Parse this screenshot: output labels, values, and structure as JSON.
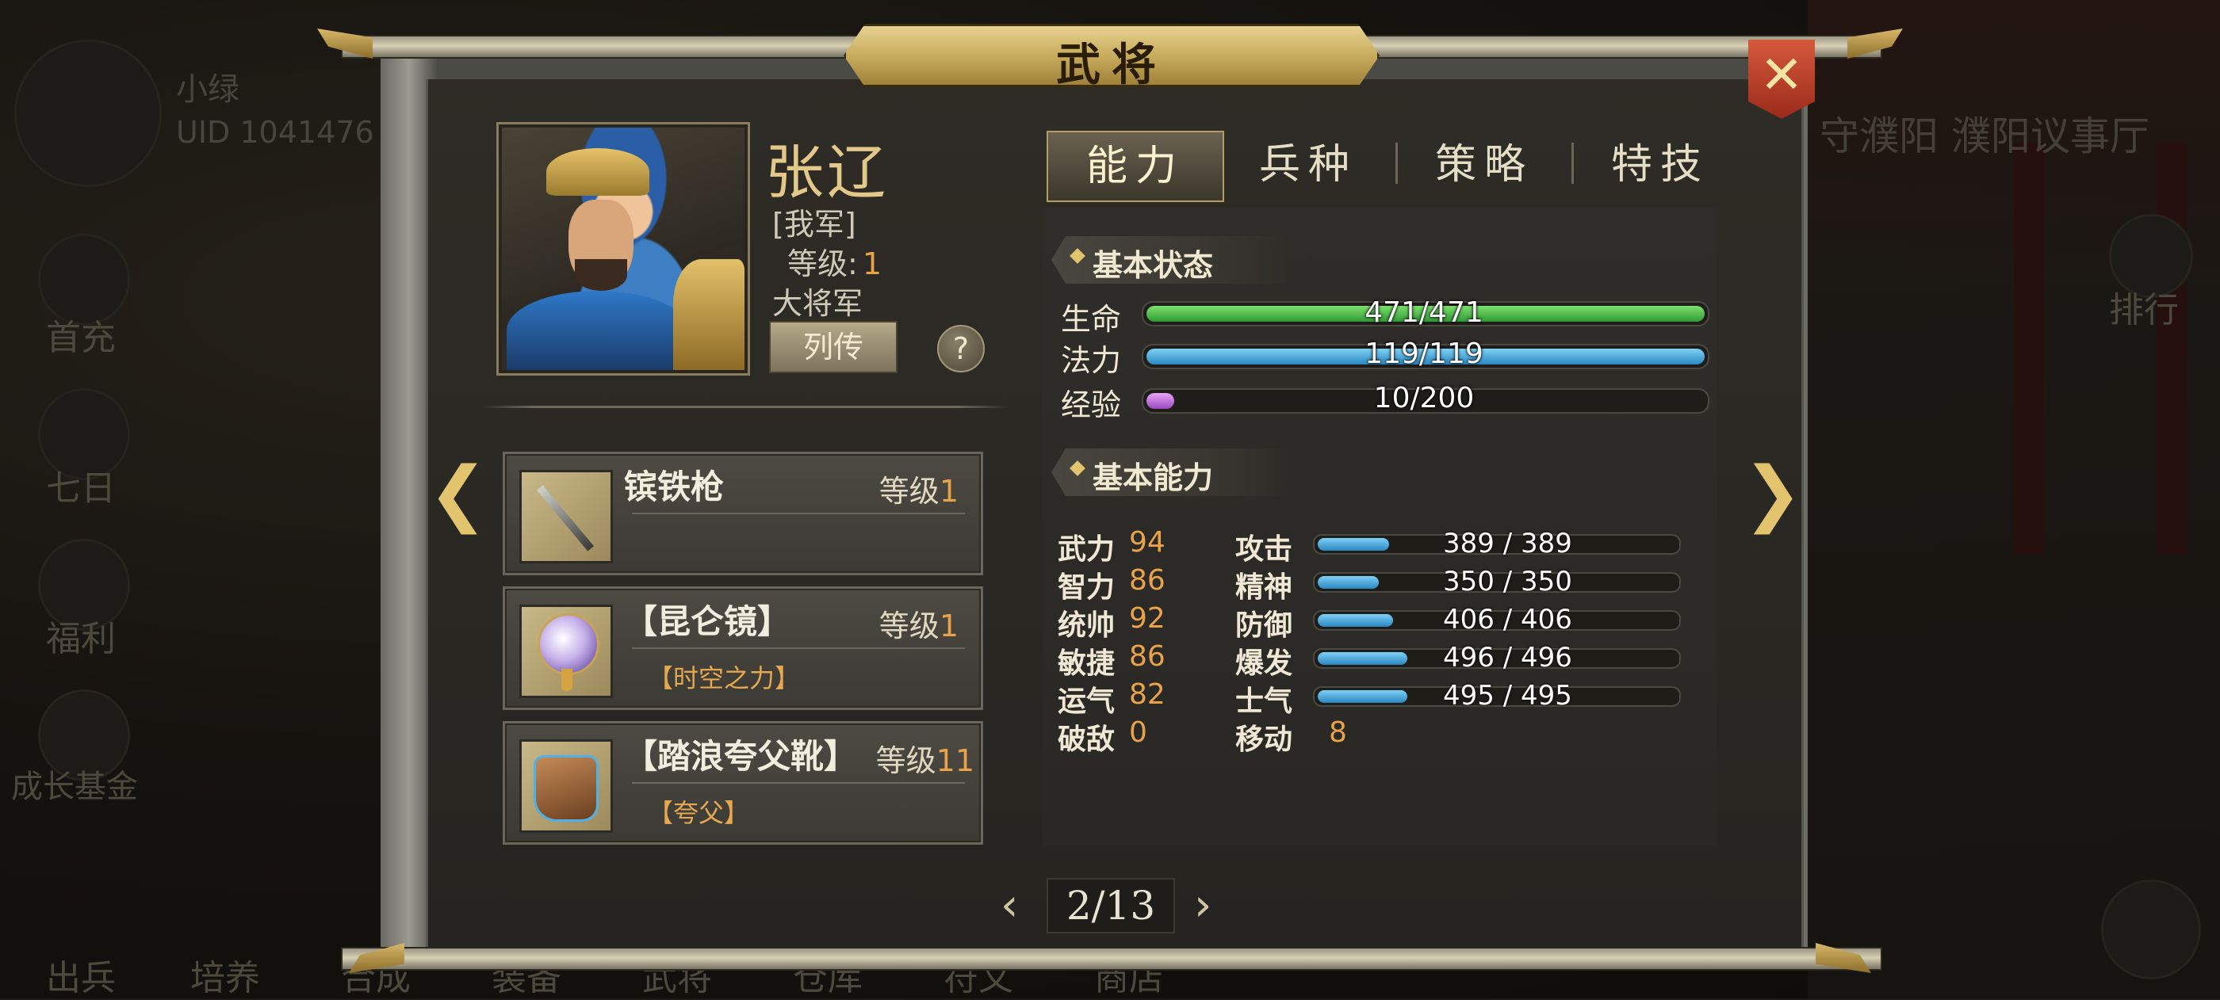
{
  "background": {
    "player_name": "小绿",
    "uid": "UID 1041476",
    "side_menu": [
      "首充",
      "七日",
      "福利",
      "成长基金"
    ],
    "bottom_menu": [
      "出兵",
      "培养",
      "合成",
      "装备",
      "武将",
      "仓库",
      "符文",
      "商店"
    ],
    "location": "守濮阳 濮阳议事厅",
    "ranking": "排行"
  },
  "panel": {
    "title": "武将",
    "close_icon": "close-x-icon"
  },
  "hero": {
    "name": "张辽",
    "faction": "[我军]",
    "level_label": "等级:",
    "level": "1",
    "rank": "大将军",
    "biography_button": "列传",
    "help_button": "?"
  },
  "equipment": [
    {
      "name": "镔铁枪",
      "level_label": "等级",
      "level": "1",
      "effect": "",
      "icon": "spear-icon"
    },
    {
      "name": "【昆仑镜】",
      "level_label": "等级",
      "level": "1",
      "effect": "【时空之力】",
      "icon": "mirror-icon"
    },
    {
      "name": "【踏浪夸父靴】",
      "level_label": "等级",
      "level": "11",
      "effect": "【夸父】",
      "icon": "boots-icon"
    }
  ],
  "pager": {
    "current": "2/13",
    "prev_icon": "chevron-left-icon",
    "next_icon": "chevron-right-icon"
  },
  "tabs": [
    {
      "label": "能力",
      "active": true
    },
    {
      "label": "兵种",
      "active": false
    },
    {
      "label": "策略",
      "active": false
    },
    {
      "label": "特技",
      "active": false
    }
  ],
  "basic_status": {
    "title": "基本状态",
    "bars": [
      {
        "label": "生命",
        "current": 471,
        "max": 471,
        "text": "471/471",
        "color": "#3fae43"
      },
      {
        "label": "法力",
        "current": 119,
        "max": 119,
        "text": "119/119",
        "color": "#3b9ad6"
      },
      {
        "label": "经验",
        "current": 10,
        "max": 200,
        "text": "10/200",
        "color": "#c36ee0"
      }
    ]
  },
  "basic_ability": {
    "title": "基本能力",
    "attributes": [
      {
        "name": "武力",
        "value": "94"
      },
      {
        "name": "智力",
        "value": "86"
      },
      {
        "name": "统帅",
        "value": "92"
      },
      {
        "name": "敏捷",
        "value": "86"
      },
      {
        "name": "运气",
        "value": "82"
      },
      {
        "name": "破敌",
        "value": "0"
      }
    ],
    "combat_stats": [
      {
        "name": "攻击",
        "text": "389 / 389",
        "fill_fraction": 0.2
      },
      {
        "name": "精神",
        "text": "350 / 350",
        "fill_fraction": 0.17
      },
      {
        "name": "防御",
        "text": "406 / 406",
        "fill_fraction": 0.21
      },
      {
        "name": "爆发",
        "text": "496 / 496",
        "fill_fraction": 0.25
      },
      {
        "name": "士气",
        "text": "495 / 495",
        "fill_fraction": 0.25
      }
    ],
    "move": {
      "name": "移动",
      "value": "8"
    }
  }
}
